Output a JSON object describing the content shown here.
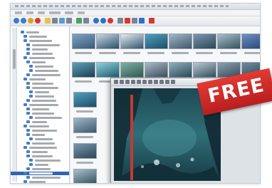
{
  "badge": {
    "label": "FREE"
  },
  "colors": {
    "badge_red": "#d42a27",
    "selection_blue": "#2f63b6",
    "viewer_bg": "#dde2e7"
  },
  "toolbar": {
    "icons": [
      "back-icon",
      "forward-icon",
      "home-icon",
      "refresh-icon",
      "folder-icon",
      "view-icon",
      "sort-icon",
      "zoom-icon",
      "settings-icon",
      "help-icon"
    ]
  }
}
